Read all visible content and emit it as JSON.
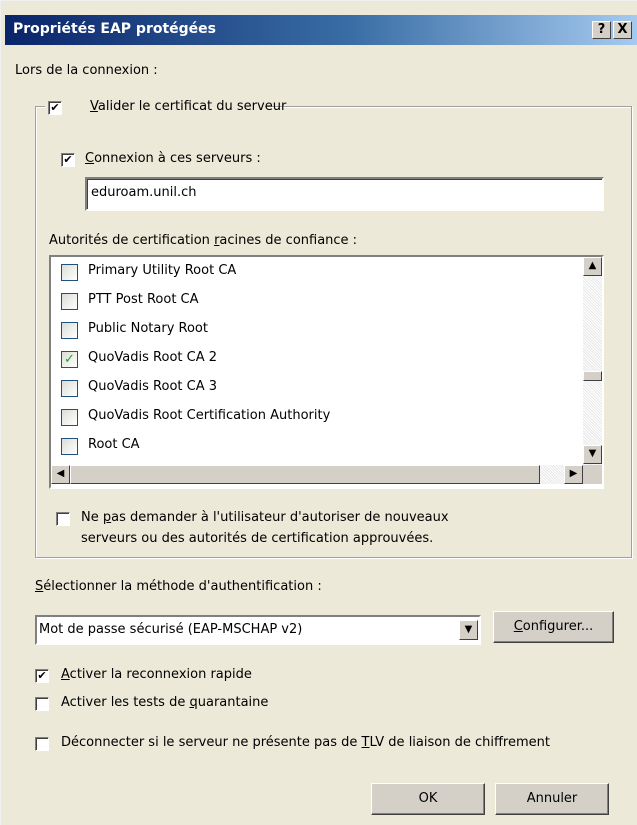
{
  "window": {
    "title": "Propriétés EAP protégées",
    "help_btn": "?",
    "close_btn": "X"
  },
  "connection_label": "Lors de la connexion :",
  "validate_cert": {
    "underline": "V",
    "label": "alider le certificat du serveur",
    "checked": true
  },
  "connect_servers": {
    "underline": "C",
    "label": "onnexion à ces serveurs :",
    "checked": true,
    "value": "eduroam.unil.ch"
  },
  "authorities": {
    "prefix": "Autorités de certification ",
    "underline": "r",
    "suffix": "acines de confiance :",
    "items": [
      {
        "label": "Primary Utility Root CA",
        "checked": false
      },
      {
        "label": "PTT Post Root CA",
        "checked": false
      },
      {
        "label": "Public Notary Root",
        "checked": false
      },
      {
        "label": "QuoVadis Root CA 2",
        "checked": true
      },
      {
        "label": "QuoVadis Root CA 3",
        "checked": false
      },
      {
        "label": "QuoVadis Root Certification Authority",
        "checked": false
      },
      {
        "label": "Root CA",
        "checked": false
      }
    ]
  },
  "dont_prompt": {
    "pre": "Ne ",
    "underline": "p",
    "line1_rest": "as demander à l'utilisateur d'autoriser de nouveaux",
    "line2": "serveurs ou des autorités de certification approuvées.",
    "checked": false
  },
  "auth_method": {
    "underline": "S",
    "label": "électionner la méthode d'authentification :",
    "selected": "Mot de passe sécurisé (EAP-MSCHAP v2)",
    "configure_underline": "C",
    "configure_rest": "onfigurer..."
  },
  "fast_reconnect": {
    "underline": "A",
    "rest": "ctiver la reconnexion rapide",
    "checked": true
  },
  "quarantine": {
    "pre": "Activer les tests de ",
    "underline": "q",
    "rest": "uarantaine",
    "checked": false
  },
  "disconnect_tlv": {
    "pre": "Déconnecter si le serveur ne présente pas de ",
    "underline": "T",
    "rest": "LV de liaison de chiffrement",
    "checked": false
  },
  "buttons": {
    "ok": "OK",
    "cancel": "Annuler"
  }
}
